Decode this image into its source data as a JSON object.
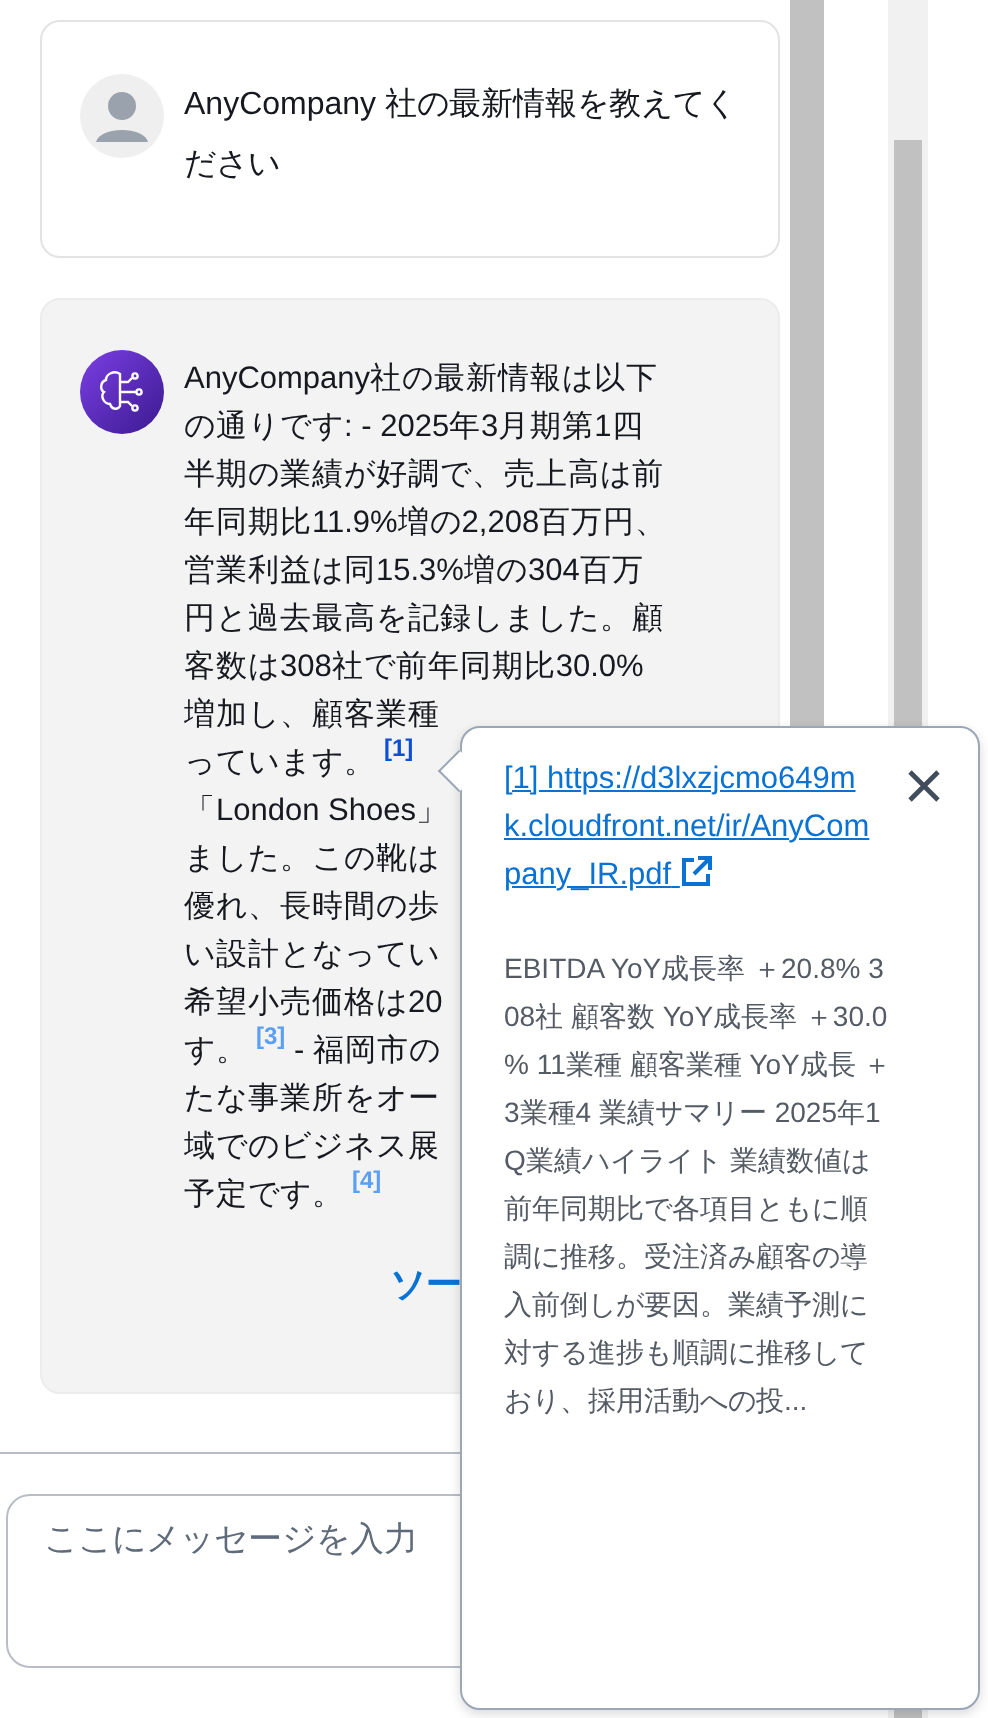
{
  "user_message": {
    "text": "AnyCompany 社の最新情報を教えてください"
  },
  "assistant_message": {
    "lines": [
      [
        {
          "kind": "text",
          "text": "AnyCompany社の最新情報は以下"
        }
      ],
      [
        {
          "kind": "text",
          "text": "の通りです: - 2025年3月期第1四"
        }
      ],
      [
        {
          "kind": "text",
          "text": "半期の業績が好調で、売上高は前"
        }
      ],
      [
        {
          "kind": "text",
          "text": "年同期比11.9%増の2,208百万円、"
        }
      ],
      [
        {
          "kind": "text",
          "text": "営業利益は同15.3%増の304百万"
        }
      ],
      [
        {
          "kind": "text",
          "text": "円と過去最高を記録しました。顧"
        }
      ],
      [
        {
          "kind": "text",
          "text": "客数は308社で前年同期比30.0%"
        }
      ],
      [
        {
          "kind": "text",
          "text": "増加し、顧客業種"
        }
      ],
      [
        {
          "kind": "text",
          "text": "っています。"
        },
        {
          "kind": "cite",
          "text": "[1]",
          "selected": true
        }
      ],
      [
        {
          "kind": "text",
          "text": "「London Shoes」"
        }
      ],
      [
        {
          "kind": "text",
          "text": "ました。この靴は"
        }
      ],
      [
        {
          "kind": "text",
          "text": "優れ、長時間の歩"
        }
      ],
      [
        {
          "kind": "text",
          "text": "い設計となってい"
        }
      ],
      [
        {
          "kind": "text",
          "text": "希望小売価格は20"
        }
      ],
      [
        {
          "kind": "text",
          "text": "す。"
        },
        {
          "kind": "cite",
          "text": "[3]",
          "selected": false
        },
        {
          "kind": "text",
          "text": " - 福岡市の"
        }
      ],
      [
        {
          "kind": "text",
          "text": "たな事業所をオー"
        }
      ],
      [
        {
          "kind": "text",
          "text": "域でのビジネス展"
        }
      ],
      [
        {
          "kind": "text",
          "text": "予定です。"
        },
        {
          "kind": "cite",
          "text": "[4]",
          "selected": false
        }
      ]
    ],
    "sources_button": "ソー"
  },
  "input": {
    "placeholder": "ここにメッセージを入力"
  },
  "citation_popover": {
    "link": "[1] https://d3lxzjcmo649mk.cloudfront.net/ir/AnyCompany_IR.pdf",
    "excerpt": "EBITDA YoY成長率 ＋20.8% 308社 顧客数 YoY成長率 ＋30.0% 11業種 顧客業種 YoY成長 ＋3業種4 業績サマリー 2025年1Q業績ハイライト 業績数値は前年同期比で各項目ともに順調に推移。受注済み顧客の導入前倒しが要因。業績予測に対する進捗も順調に推移しており、採用活動への投..."
  }
}
